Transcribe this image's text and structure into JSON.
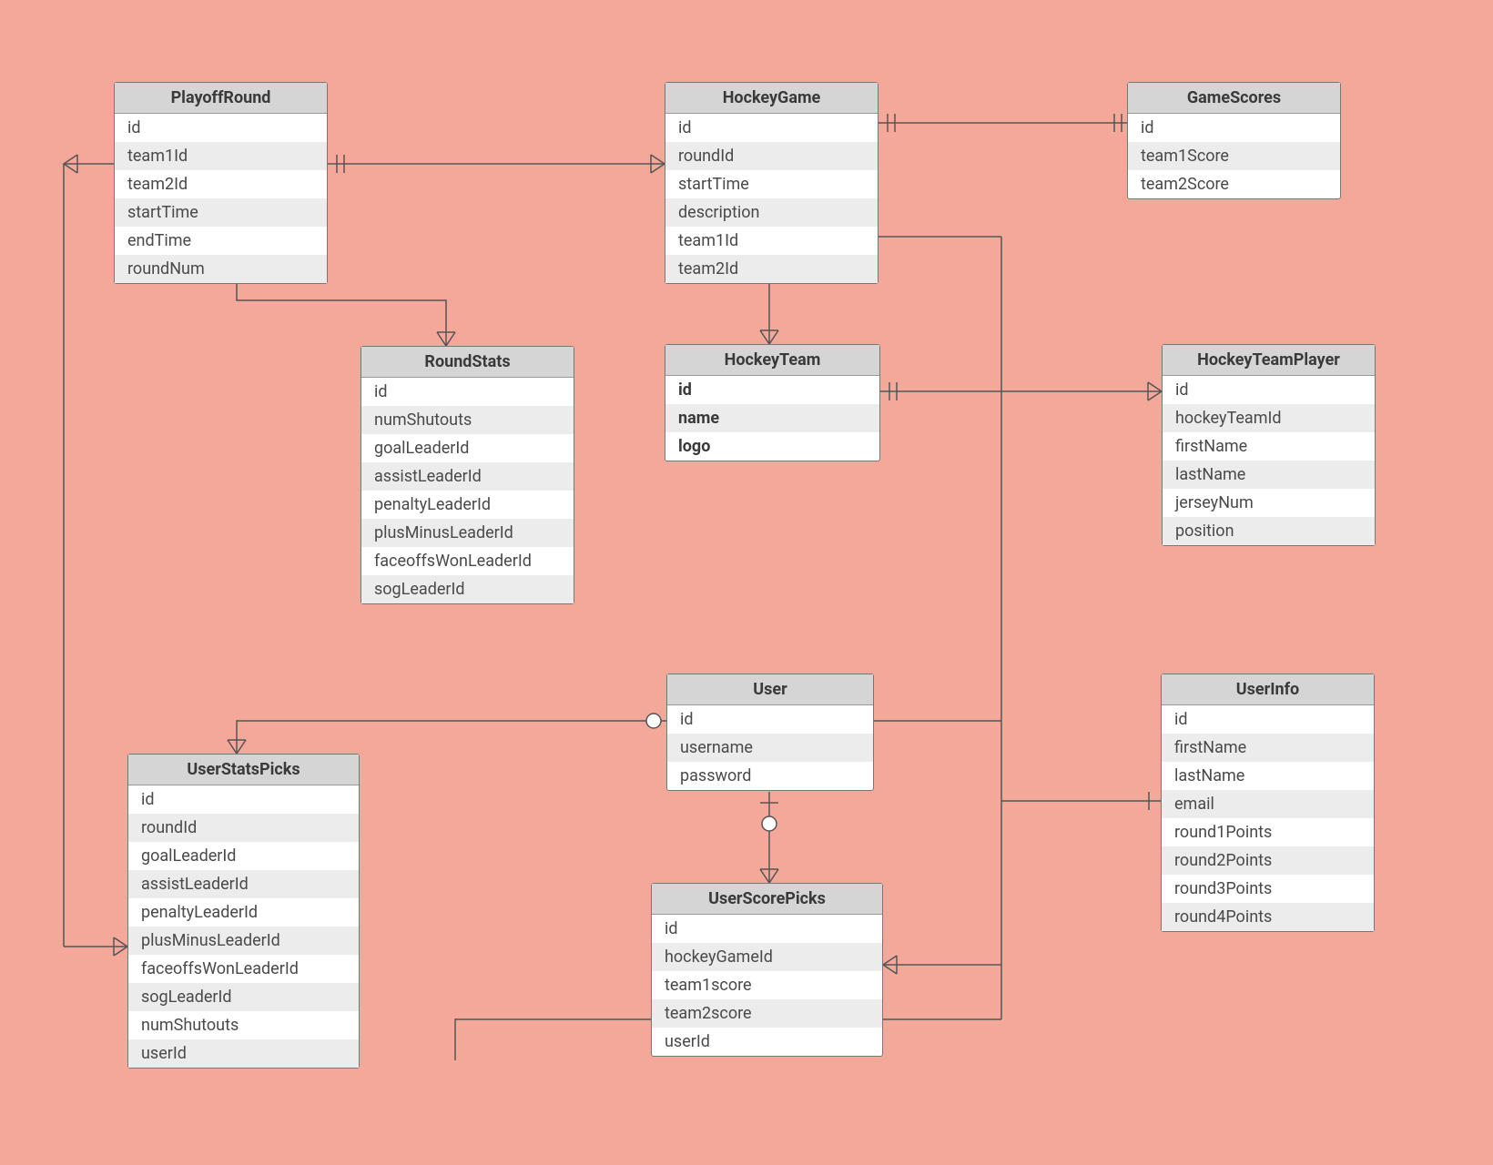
{
  "entities": {
    "playoffRound": {
      "title": "PlayoffRound",
      "fields": [
        "id",
        "team1Id",
        "team2Id",
        "startTime",
        "endTime",
        "roundNum"
      ]
    },
    "hockeyGame": {
      "title": "HockeyGame",
      "fields": [
        "id",
        "roundId",
        "startTime",
        "description",
        "team1Id",
        "team2Id"
      ]
    },
    "gameScores": {
      "title": "GameScores",
      "fields": [
        "id",
        "team1Score",
        "team2Score"
      ]
    },
    "roundStats": {
      "title": "RoundStats",
      "fields": [
        "id",
        "numShutouts",
        "goalLeaderId",
        "assistLeaderId",
        "penaltyLeaderId",
        "plusMinusLeaderId",
        "faceoffsWonLeaderId",
        "sogLeaderId"
      ]
    },
    "hockeyTeam": {
      "title": "HockeyTeam",
      "fields": [
        "id",
        "name",
        "logo"
      ]
    },
    "hockeyTeamPlayer": {
      "title": "HockeyTeamPlayer",
      "fields": [
        "id",
        "hockeyTeamId",
        "firstName",
        "lastName",
        "jerseyNum",
        "position"
      ]
    },
    "user": {
      "title": "User",
      "fields": [
        "id",
        "username",
        "password"
      ]
    },
    "userInfo": {
      "title": "UserInfo",
      "fields": [
        "id",
        "firstName",
        "lastName",
        "email",
        "round1Points",
        "round2Points",
        "round3Points",
        "round4Points"
      ]
    },
    "userStatsPicks": {
      "title": "UserStatsPicks",
      "fields": [
        "id",
        "roundId",
        "goalLeaderId",
        "assistLeaderId",
        "penaltyLeaderId",
        "plusMinusLeaderId",
        "faceoffsWonLeaderId",
        "sogLeaderId",
        "numShutouts",
        "userId"
      ]
    },
    "userScorePicks": {
      "title": "UserScorePicks",
      "fields": [
        "id",
        "hockeyGameId",
        "team1score",
        "team2score",
        "userId"
      ]
    }
  }
}
